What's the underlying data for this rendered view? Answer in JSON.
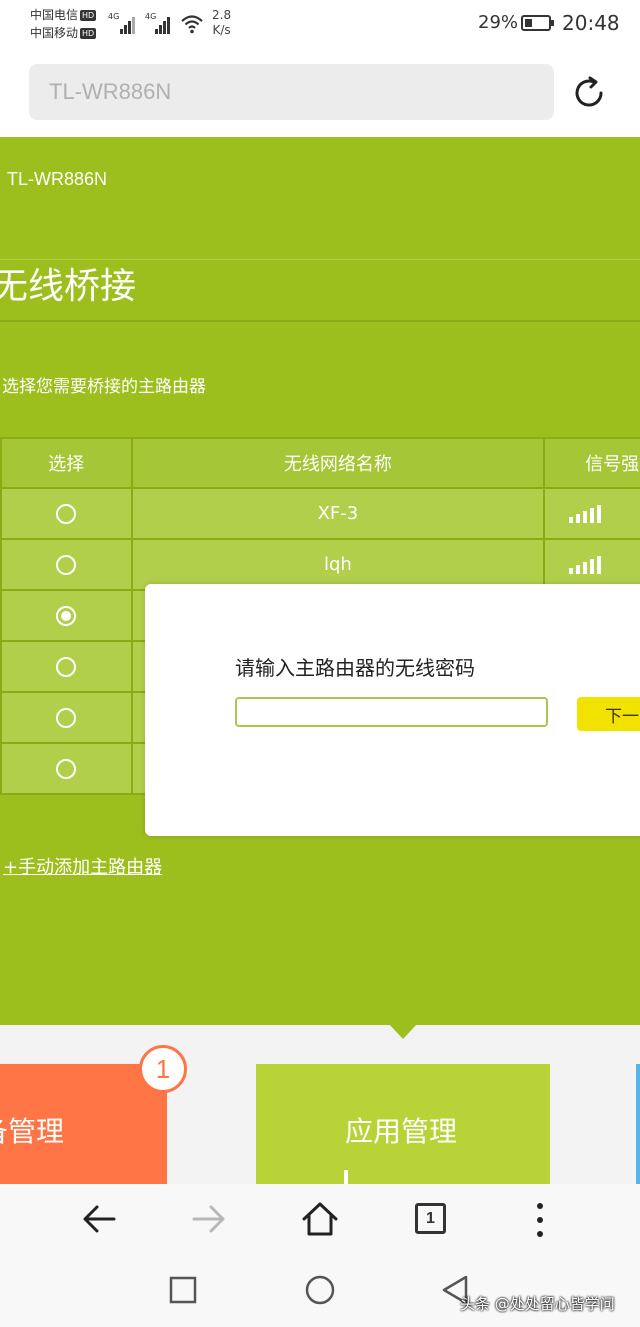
{
  "status_bar": {
    "carrier_1": "中国电信",
    "carrier_2": "中国移动",
    "hd_1": "HD",
    "hd_2": "HD",
    "network_1": "4G",
    "network_2": "4G",
    "speed_value": "2.8",
    "speed_unit": "K/s",
    "battery": "29%",
    "time": "20:48"
  },
  "address_bar": {
    "url": "TL-WR886N"
  },
  "page": {
    "router_model": "TL-WR886N",
    "title": "无线桥接",
    "instruction": "选择您需要桥接的主路由器",
    "table": {
      "headers": [
        "选择",
        "无线网络名称",
        "信号强"
      ],
      "rows": [
        {
          "selected": false,
          "ssid": "XF-3",
          "signal": 4
        },
        {
          "selected": false,
          "ssid": "lqh",
          "signal": 4
        },
        {
          "selected": true,
          "ssid": "",
          "signal": 0
        },
        {
          "selected": false,
          "ssid": "",
          "signal": 0
        },
        {
          "selected": false,
          "ssid": "",
          "signal": 0
        },
        {
          "selected": false,
          "ssid": "",
          "signal": 0
        }
      ]
    },
    "add_router_link": "+手动添加主路由器"
  },
  "dialog": {
    "title": "请输入主路由器的无线密码",
    "password_value": "",
    "next_button": "下一"
  },
  "app_cards": {
    "device_manage": "备管理",
    "device_badge": "1",
    "app_manage": "应用管理"
  },
  "toolbar": {
    "tab_count": "1"
  },
  "watermark": "头条 @处处留心皆学问",
  "colors": {
    "page_green": "#9cbf1e",
    "device_card": "#ff7545",
    "app_card": "#b7d337",
    "next_button": "#f2e200"
  }
}
